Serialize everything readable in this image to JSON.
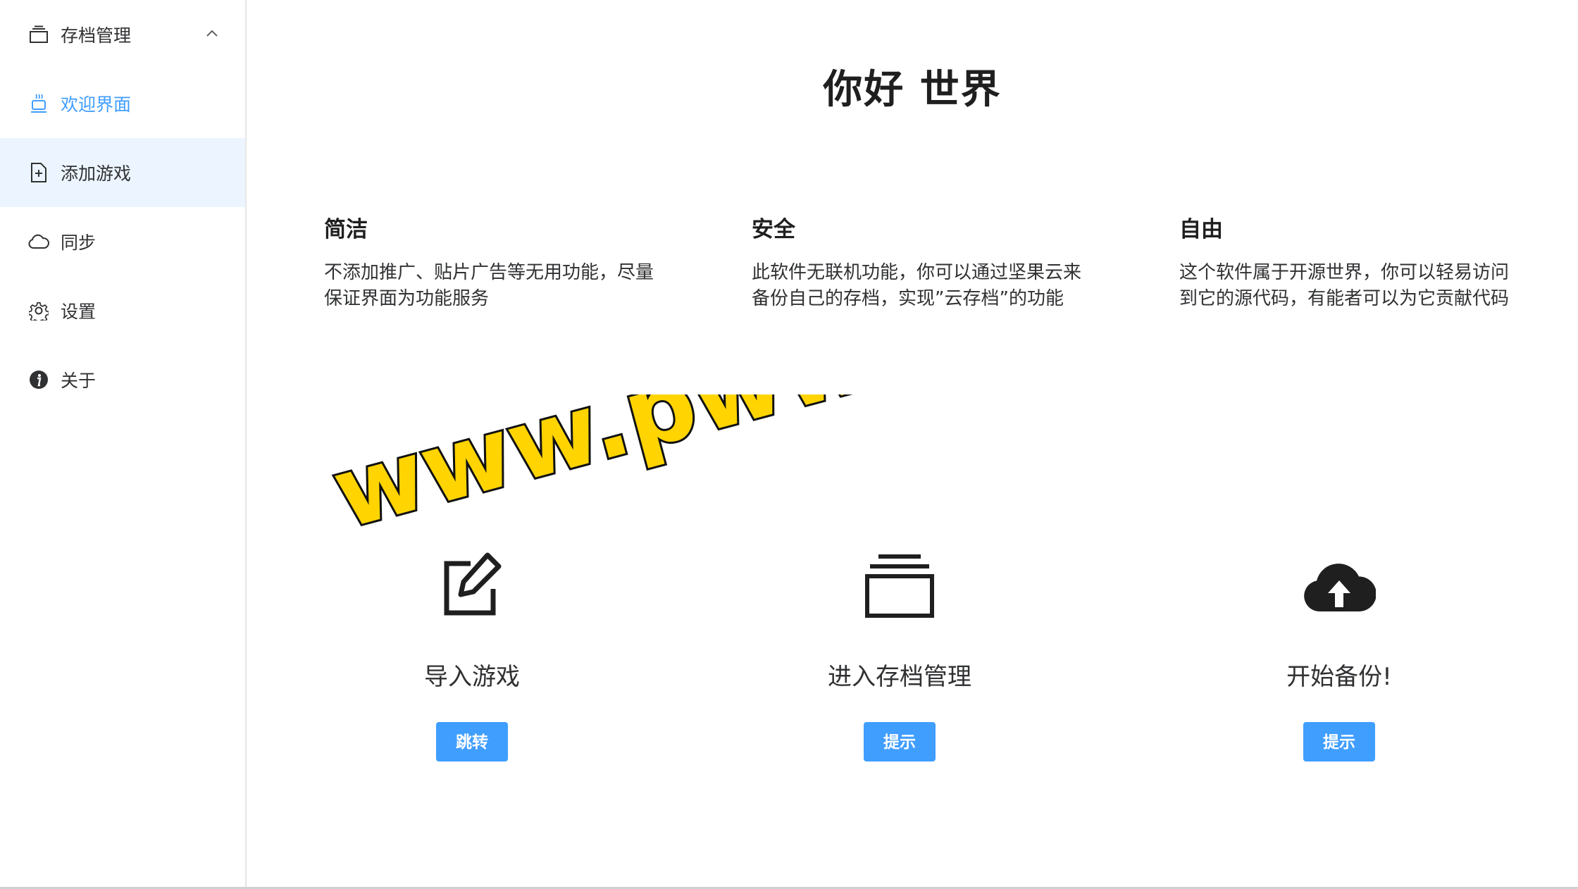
{
  "sidebar": {
    "items": [
      {
        "label": "存档管理",
        "icon": "archive-icon",
        "expanded": true
      },
      {
        "label": "欢迎界面",
        "icon": "coffee-icon",
        "active": true
      },
      {
        "label": "添加游戏",
        "icon": "document-add-icon",
        "hovered": true
      },
      {
        "label": "同步",
        "icon": "cloud-icon"
      },
      {
        "label": "设置",
        "icon": "gear-icon"
      },
      {
        "label": "关于",
        "icon": "info-icon"
      }
    ]
  },
  "main": {
    "title": "你好 世界",
    "features": [
      {
        "heading": "简洁",
        "text": "不添加推广、贴片广告等无用功能，尽量保证界面为功能服务"
      },
      {
        "heading": "安全",
        "text": "此软件无联机功能，你可以通过坚果云来备份自己的存档，实现”云存档”的功能"
      },
      {
        "heading": "自由",
        "text": "这个软件属于开源世界，你可以轻易访问到它的源代码，有能者可以为它贡献代码"
      }
    ],
    "actions": [
      {
        "label": "导入游戏",
        "button": "跳转",
        "icon": "edit-icon"
      },
      {
        "label": "进入存档管理",
        "button": "提示",
        "icon": "archive-icon"
      },
      {
        "label": "开始备份!",
        "button": "提示",
        "icon": "cloud-upload-icon"
      }
    ]
  },
  "watermark": "www.pwwwu.com",
  "colors": {
    "accent": "#409eff",
    "hover_bg": "#ecf5ff",
    "watermark_fill": "#ffd400"
  }
}
